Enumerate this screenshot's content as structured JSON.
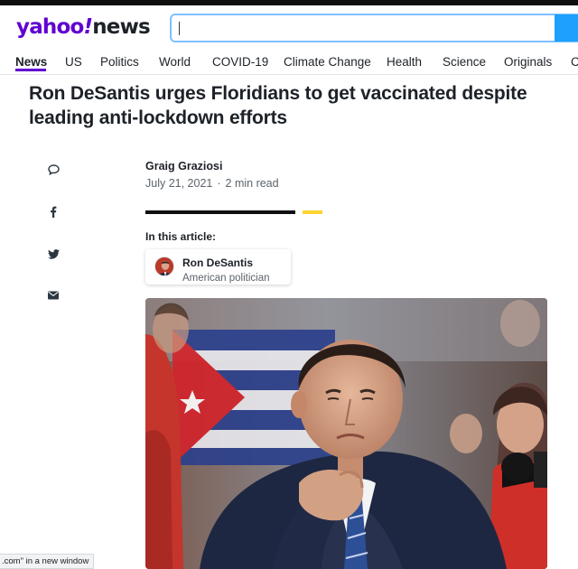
{
  "header": {
    "logo_brand": "yahoo",
    "logo_slash": "!",
    "logo_product": "news",
    "search": {
      "value": "",
      "placeholder": ""
    }
  },
  "nav": {
    "items": [
      {
        "label": "News",
        "active": true
      },
      {
        "label": "US"
      },
      {
        "label": "Politics"
      },
      {
        "label": "World"
      },
      {
        "label": "COVID-19"
      },
      {
        "label": "Climate Change"
      },
      {
        "label": "Health"
      },
      {
        "label": "Science"
      },
      {
        "label": "Originals"
      },
      {
        "label": "C"
      }
    ]
  },
  "article": {
    "title": "Ron DeSantis urges Floridians to get vaccinated despite leading anti-lockdown efforts",
    "author": "Graig Graziosi",
    "date": "July 21, 2021",
    "separator": "·",
    "read_time": "2 min read",
    "in_this_article_label": "In this article:",
    "entity": {
      "name": "Ron DeSantis",
      "description": "American politician"
    }
  },
  "share_icons": [
    "comment-icon",
    "facebook-icon",
    "twitter-icon",
    "mail-icon"
  ],
  "status_bar": {
    "text": ".com\" in a new window"
  },
  "colors": {
    "brand_purple": "#6001d2",
    "search_border": "#7ec0ff",
    "search_button": "#1ea0ff",
    "accent_yellow": "#ffd333"
  }
}
